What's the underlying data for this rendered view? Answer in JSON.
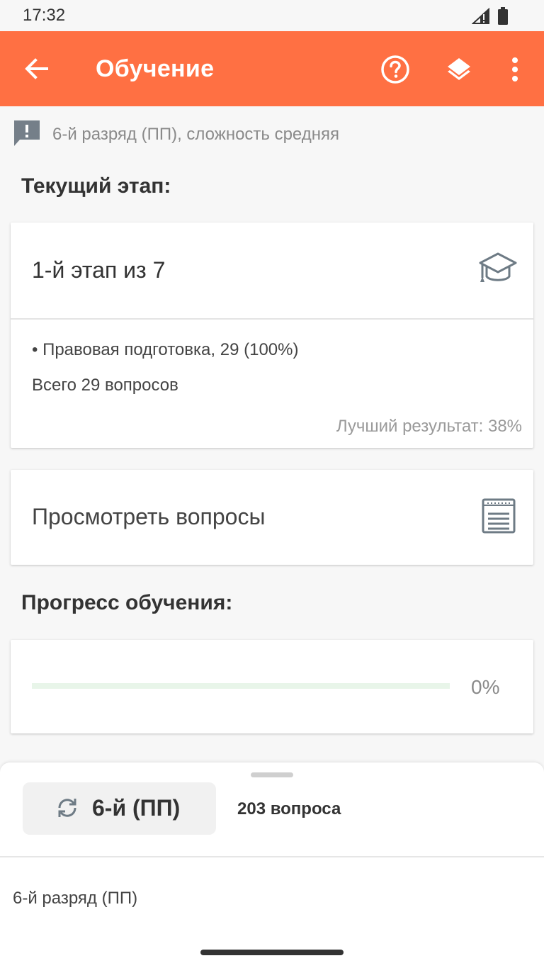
{
  "status_bar": {
    "time": "17:32",
    "signal_icon": "signal-icon",
    "battery_icon": "battery-icon"
  },
  "app_bar": {
    "title": "Обучение",
    "background_color": "#ff7043",
    "back_icon": "arrow-back-icon",
    "actions": [
      "help-icon",
      "layers-icon",
      "more-vert-icon"
    ]
  },
  "subtitle": {
    "icon": "feedback-icon",
    "text": "6-й разряд (ПП), сложность средняя"
  },
  "current_stage": {
    "heading": "Текущий этап:",
    "name": "1-й этап из 7",
    "icon": "graduation-cap-icon",
    "topic": "• Правовая подготовка, 29 (100%)",
    "total": "Всего 29 вопросов",
    "best_result": "Лучший результат: 38%"
  },
  "view_questions": {
    "label": "Просмотреть вопросы",
    "icon": "list-document-icon"
  },
  "progress": {
    "heading": "Прогресс обучения:",
    "value_percent": 0,
    "label": "0%",
    "track_color": "#e8f5e9",
    "fill_color": "#66bb6a"
  },
  "bottom_sheet": {
    "level_label": "6-й (ПП)",
    "level_icon": "sync-icon",
    "question_count": "203 вопроса",
    "items": [
      "6-й разряд (ПП)"
    ]
  }
}
